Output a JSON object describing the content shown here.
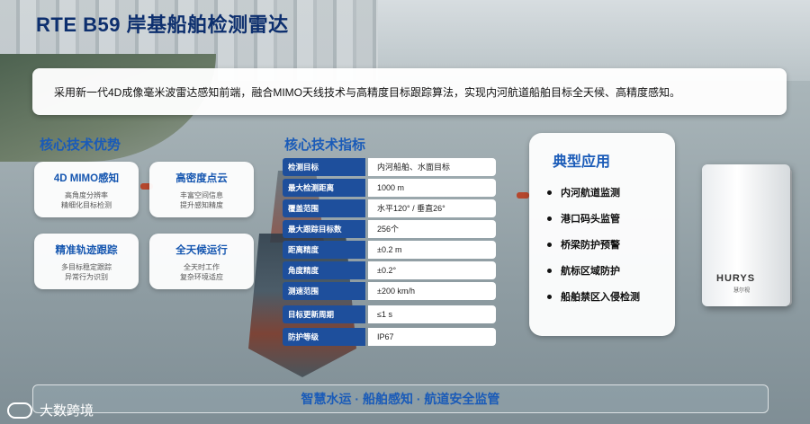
{
  "title": "RTE B59 岸基船舶检测雷达",
  "intro": "采用新一代4D成像毫米波雷达感知前端，融合MIMO天线技术与高精度目标跟踪算法，实现内河航道船舶目标全天候、高精度感知。",
  "core_advantages": {
    "title": "核心技术优势",
    "cards": [
      {
        "title": "4D MIMO感知",
        "line1": "高角度分辨率",
        "line2": "精细化目标检测"
      },
      {
        "title": "高密度点云",
        "line1": "丰富空间信息",
        "line2": "提升感知精度"
      },
      {
        "title": "精准轨迹跟踪",
        "line1": "多目标稳定跟踪",
        "line2": "异常行为识别"
      },
      {
        "title": "全天候运行",
        "line1": "全天时工作",
        "line2": "复杂环境适应"
      }
    ]
  },
  "specs": {
    "title": "核心技术指标",
    "rows": [
      {
        "key": "检测目标",
        "value": "内河船舶、水面目标"
      },
      {
        "key": "最大检测距离",
        "value": "1000 m"
      },
      {
        "key": "覆盖范围",
        "value": "水平120° / 垂直26°"
      },
      {
        "key": "最大跟踪目标数",
        "value": "256个"
      },
      {
        "key": "距离精度",
        "value": "±0.2 m"
      },
      {
        "key": "角度精度",
        "value": "±0.2°"
      },
      {
        "key": "测速范围",
        "value": "±200 km/h"
      },
      {
        "key": "目标更新周期",
        "value": "≤1 s"
      },
      {
        "key": "防护等级",
        "value": "IP67"
      }
    ]
  },
  "applications": {
    "title": "典型应用",
    "items": [
      "内河航道监测",
      "港口码头监管",
      "桥梁防护预警",
      "航标区域防护",
      "船舶禁区入侵检测"
    ]
  },
  "device": {
    "logo": "HURYS",
    "sub": "慧尔视"
  },
  "footer": "智慧水运 · 船舶感知 · 航道安全监管",
  "brand": "大数跨境",
  "colors": {
    "accent": "#1a5bb8",
    "title": "#0d2f6e",
    "spec_key_bg": "#1e4f9c"
  }
}
